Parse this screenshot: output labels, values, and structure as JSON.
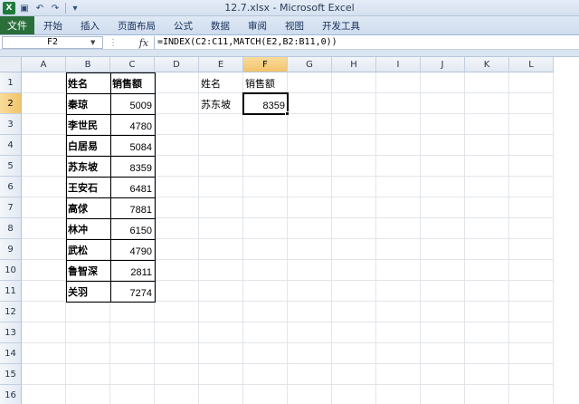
{
  "titlebar": {
    "logo": "X",
    "title": "12.7.xlsx - Microsoft Excel",
    "qa_icons": [
      "save-icon",
      "undo-icon",
      "redo-icon",
      "customize-icon"
    ],
    "qa_glyphs": [
      "▣",
      "↶",
      "↷",
      "▾"
    ]
  },
  "ribbon": {
    "file_tab": "文件",
    "tabs": [
      "开始",
      "插入",
      "页面布局",
      "公式",
      "数据",
      "审阅",
      "视图",
      "开发工具"
    ]
  },
  "formula_bar": {
    "name_box": "F2",
    "fx": "fx",
    "formula": "=INDEX(C2:C11,MATCH(E2,B2:B11,0))"
  },
  "columns": [
    "A",
    "B",
    "C",
    "D",
    "E",
    "F",
    "G",
    "H",
    "I",
    "J",
    "K",
    "L"
  ],
  "rows": [
    "1",
    "2",
    "3",
    "4",
    "5",
    "6",
    "7",
    "8",
    "9",
    "10",
    "11",
    "12",
    "13",
    "14",
    "15",
    "16"
  ],
  "active_cell": "F2",
  "table": {
    "header": [
      "姓名",
      "销售额"
    ],
    "rows": [
      [
        "秦琼",
        "5009"
      ],
      [
        "李世民",
        "4780"
      ],
      [
        "白居易",
        "5084"
      ],
      [
        "苏东坡",
        "8359"
      ],
      [
        "王安石",
        "6481"
      ],
      [
        "高俅",
        "7881"
      ],
      [
        "林冲",
        "6150"
      ],
      [
        "武松",
        "4790"
      ],
      [
        "鲁智深",
        "2811"
      ],
      [
        "关羽",
        "7274"
      ]
    ]
  },
  "lookup": {
    "header": [
      "姓名",
      "销售额"
    ],
    "name": "苏东坡",
    "result": "8359"
  }
}
